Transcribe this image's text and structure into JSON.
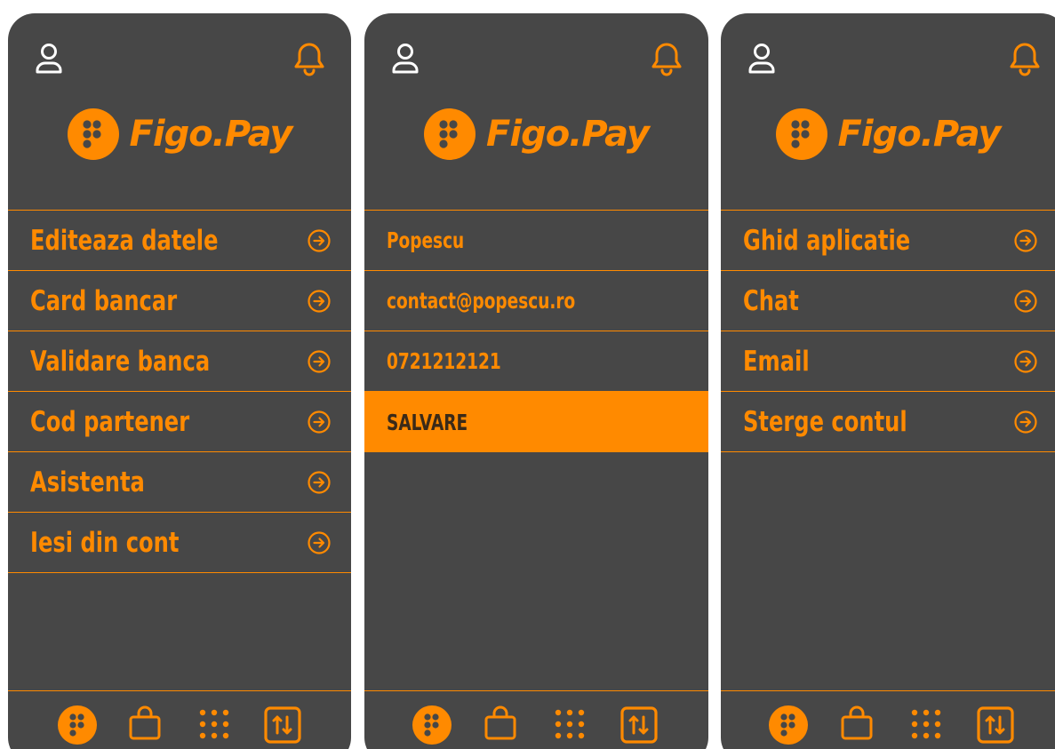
{
  "colors": {
    "accent": "#ff8a00",
    "panel_bg": "#474747",
    "page_bg": "#ffffff",
    "save_text": "#3a2a18"
  },
  "brand": {
    "name": "Figo.Pay",
    "logo_icon": "figo-dots-logo-icon"
  },
  "header_icons": {
    "left": "user-icon",
    "right": "bell-icon"
  },
  "screens": [
    {
      "menu": [
        {
          "label": "Editeaza datele",
          "icon": "arrow-right-circle-icon"
        },
        {
          "label": "Card bancar",
          "icon": "arrow-right-circle-icon"
        },
        {
          "label": "Validare banca",
          "icon": "arrow-right-circle-icon"
        },
        {
          "label": "Cod partener",
          "icon": "arrow-right-circle-icon"
        },
        {
          "label": "Asistenta",
          "icon": "arrow-right-circle-icon"
        },
        {
          "label": "Iesi din cont",
          "icon": "arrow-right-circle-icon"
        }
      ]
    },
    {
      "form": {
        "name": "Popescu",
        "email": "contact@popescu.ro",
        "phone": "0721212121",
        "save_label": "SALVARE"
      }
    },
    {
      "menu": [
        {
          "label": "Ghid aplicatie",
          "icon": "arrow-right-circle-icon"
        },
        {
          "label": "Chat",
          "icon": "arrow-right-circle-icon"
        },
        {
          "label": "Email",
          "icon": "arrow-right-circle-icon"
        },
        {
          "label": "Sterge contul",
          "icon": "arrow-right-circle-icon"
        }
      ]
    }
  ],
  "bottom_nav": [
    {
      "icon": "figo-home-icon"
    },
    {
      "icon": "shopping-bag-icon"
    },
    {
      "icon": "apps-grid-icon"
    },
    {
      "icon": "transfer-icon"
    }
  ]
}
